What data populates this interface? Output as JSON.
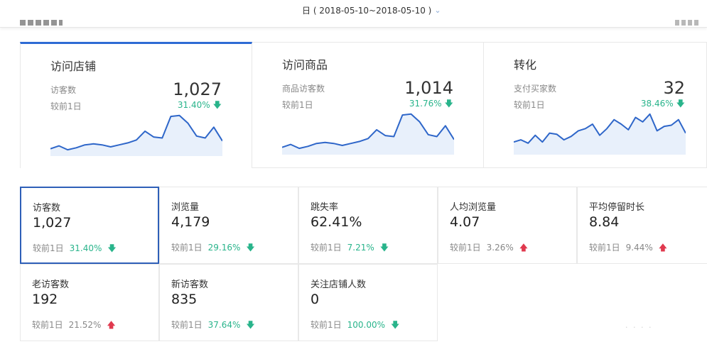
{
  "header": {
    "date_range": "日 ( 2018-05-10~2018-05-10 )",
    "chevron": "chevron-down-icon"
  },
  "colors": {
    "accent": "#2e6bd4",
    "down": "#29b48b",
    "up": "#e0394e",
    "line": "#2e66c9",
    "fill": "#e8f0fb"
  },
  "cards": [
    {
      "title": "访问店铺",
      "sub": "访客数",
      "cmp": "较前1日",
      "value": "1,027",
      "pct": "31.40%",
      "trend": "down",
      "spark": [
        6,
        9,
        5,
        7,
        10,
        11,
        10,
        8,
        10,
        12,
        15,
        24,
        18,
        17,
        39,
        40,
        32,
        19,
        17,
        28,
        14
      ]
    },
    {
      "title": "访问商品",
      "sub": "商品访客数",
      "cmp": "较前1日",
      "value": "1,014",
      "pct": "31.76%",
      "trend": "down",
      "spark": [
        6,
        9,
        5,
        7,
        10,
        11,
        10,
        8,
        10,
        12,
        15,
        24,
        18,
        17,
        39,
        40,
        32,
        19,
        17,
        28,
        14
      ]
    },
    {
      "title": "转化",
      "sub": "支付买家数",
      "cmp": "较前1日",
      "value": "32",
      "pct": "38.46%",
      "trend": "down",
      "spark": [
        10,
        12,
        9,
        16,
        10,
        18,
        17,
        12,
        15,
        20,
        22,
        26,
        16,
        22,
        30,
        26,
        21,
        32,
        28,
        35,
        20,
        24,
        25,
        30,
        18
      ]
    }
  ],
  "metrics": [
    {
      "label": "访客数",
      "value": "1,027",
      "cmp": "较前1日",
      "pct": "31.40%",
      "trend": "down"
    },
    {
      "label": "浏览量",
      "value": "4,179",
      "cmp": "较前1日",
      "pct": "29.16%",
      "trend": "down"
    },
    {
      "label": "跳失率",
      "value": "62.41%",
      "cmp": "较前1日",
      "pct": "7.21%",
      "trend": "down"
    },
    {
      "label": "人均浏览量",
      "value": "4.07",
      "cmp": "较前1日",
      "pct": "3.26%",
      "trend": "up"
    },
    {
      "label": "平均停留时长",
      "value": "8.84",
      "cmp": "较前1日",
      "pct": "9.44%",
      "trend": "up"
    },
    {
      "label": "老访客数",
      "value": "192",
      "cmp": "较前1日",
      "pct": "21.52%",
      "trend": "up"
    },
    {
      "label": "新访客数",
      "value": "835",
      "cmp": "较前1日",
      "pct": "37.64%",
      "trend": "down"
    },
    {
      "label": "关注店铺人数",
      "value": "0",
      "cmp": "较前1日",
      "pct": "100.00%",
      "trend": "down"
    }
  ]
}
